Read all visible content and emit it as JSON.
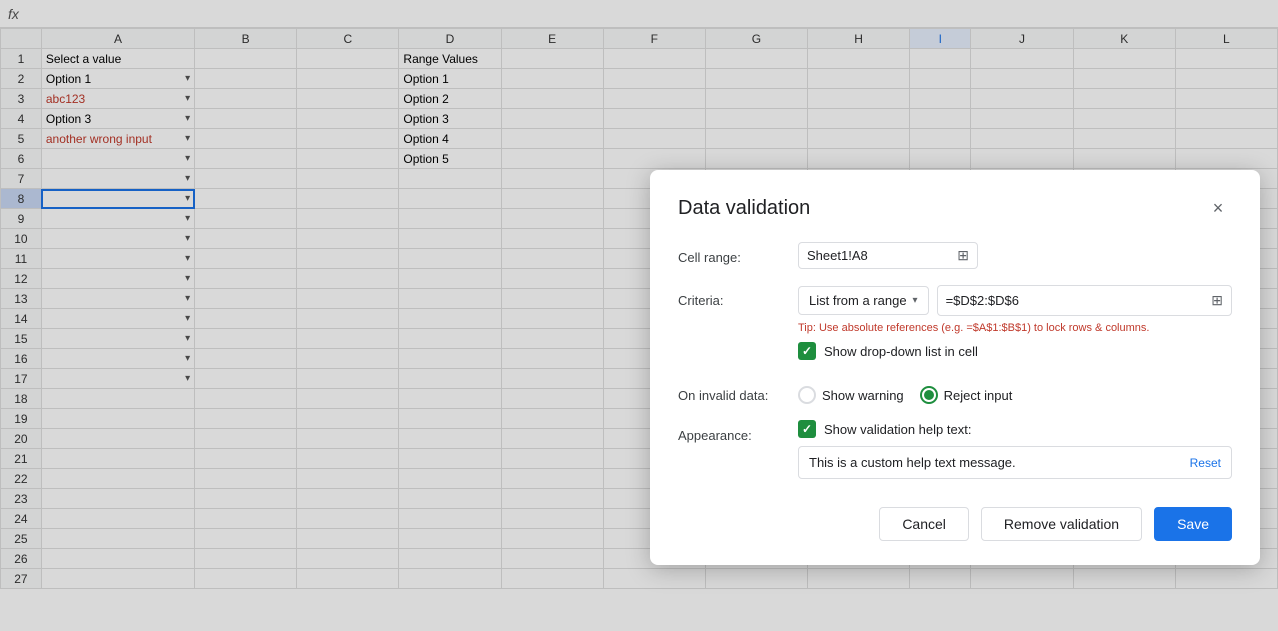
{
  "formulaBar": {
    "icon": "fx"
  },
  "columns": [
    "A",
    "B",
    "C",
    "D",
    "E",
    "F",
    "G",
    "H",
    "I",
    "J",
    "K",
    "L"
  ],
  "rows": [
    {
      "num": 1,
      "a": "Select a value",
      "d": "Range Values"
    },
    {
      "num": 2,
      "a": "Option 1",
      "a_dropdown": true,
      "d": "Option 1"
    },
    {
      "num": 3,
      "a": "abc123",
      "a_dropdown": true,
      "a_red": true,
      "d": "Option 2"
    },
    {
      "num": 4,
      "a": "Option 3",
      "a_dropdown": true,
      "d": "Option 3"
    },
    {
      "num": 5,
      "a": "another wrong input",
      "a_dropdown": true,
      "a_red": true,
      "d": "Option 4"
    },
    {
      "num": 6,
      "a": "",
      "a_dropdown": true,
      "d": "Option 5"
    },
    {
      "num": 7,
      "a": "",
      "a_dropdown": true
    },
    {
      "num": 8,
      "a": "",
      "a_dropdown": true,
      "selected": true
    },
    {
      "num": 9,
      "a": "",
      "a_dropdown": true
    },
    {
      "num": 10,
      "a": "",
      "a_dropdown": true
    },
    {
      "num": 11,
      "a": "",
      "a_dropdown": true
    },
    {
      "num": 12,
      "a": "",
      "a_dropdown": true
    },
    {
      "num": 13,
      "a": "",
      "a_dropdown": true
    },
    {
      "num": 14,
      "a": "",
      "a_dropdown": true
    },
    {
      "num": 15,
      "a": "",
      "a_dropdown": true
    },
    {
      "num": 16,
      "a": "",
      "a_dropdown": true
    },
    {
      "num": 17,
      "a": "",
      "a_dropdown": true
    },
    {
      "num": 18
    },
    {
      "num": 19
    },
    {
      "num": 20
    },
    {
      "num": 21
    },
    {
      "num": 22
    },
    {
      "num": 23
    },
    {
      "num": 24
    },
    {
      "num": 25
    },
    {
      "num": 26
    },
    {
      "num": 27
    }
  ],
  "dialog": {
    "title": "Data validation",
    "cellRangeLabel": "Cell range:",
    "cellRangeValue": "Sheet1!A8",
    "criteriaLabel": "Criteria:",
    "criteriaType": "List from a range",
    "criteriaRange": "=$D$2:$D$6",
    "tipText": "Tip: Use absolute references (e.g. =$A$1:$B$1) to lock rows & columns.",
    "showDropdownLabel": "Show drop-down list in cell",
    "onInvalidLabel": "On invalid data:",
    "showWarningLabel": "Show warning",
    "rejectInputLabel": "Reject input",
    "appearanceLabel": "Appearance:",
    "showHelpTextLabel": "Show validation help text:",
    "helpTextValue": "This is a custom help text message.",
    "resetLabel": "Reset",
    "cancelLabel": "Cancel",
    "removeValidationLabel": "Remove validation",
    "saveLabel": "Save",
    "closeIcon": "×"
  }
}
